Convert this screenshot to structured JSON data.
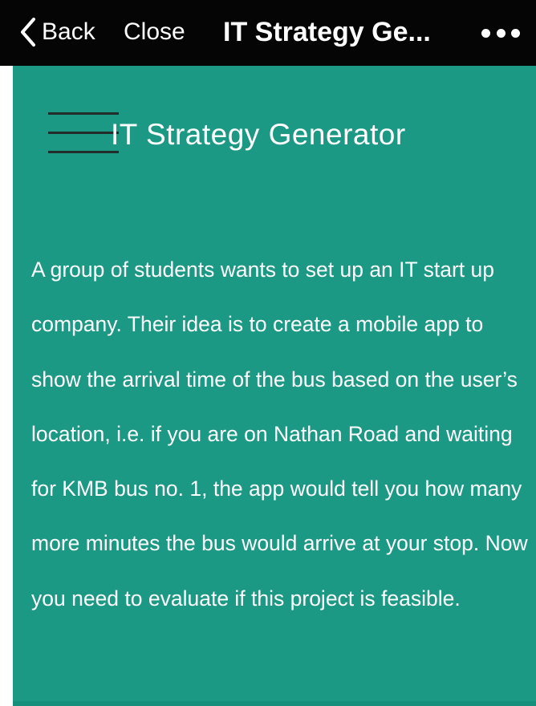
{
  "navbar": {
    "back_label": "Back",
    "close_label": "Close",
    "title": "IT Strategy Ge...",
    "icons": {
      "back": "chevron-left-icon",
      "more": "more-dots-icon"
    }
  },
  "content": {
    "menu_icon": "hamburger-menu-icon",
    "title": "IT Strategy Generator",
    "description": "A group of students wants to set up an IT start up company. Their idea is to create a mobile app to show the arrival time of the bus based on the user’s location, i.e. if you are on Nathan Road and waiting for KMB bus no. 1, the app would tell you how many more minutes the bus would arrive at your stop. Now you need to evaluate if this project is feasible."
  },
  "colors": {
    "navbar_background": "#050505",
    "panel_background": "#1b9985",
    "text": "#ffffff",
    "menu_icon": "#222d2b"
  }
}
